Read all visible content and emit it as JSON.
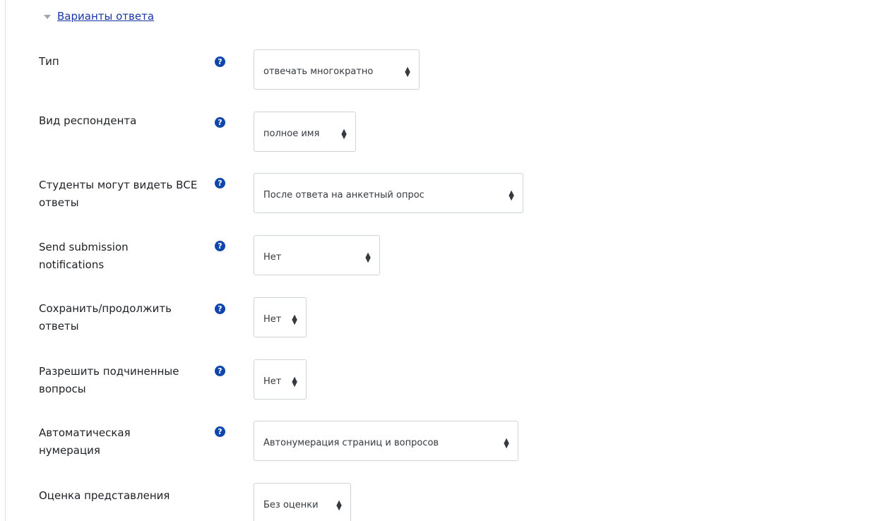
{
  "section": {
    "title": "Варианты ответа"
  },
  "fields": [
    {
      "label": "Тип",
      "value": "отвечать многократно"
    },
    {
      "label": "Вид респондента",
      "value": "полное имя"
    },
    {
      "label": "Студенты могут видеть ВСЕ ответы",
      "value": "После ответа на анкетный опрос"
    },
    {
      "label": "Send submission notifications",
      "value": "Нет"
    },
    {
      "label": "Сохранить/продолжить ответы",
      "value": "Нет"
    },
    {
      "label": "Разрешить подчиненные вопросы",
      "value": "Нет"
    },
    {
      "label": "Автоматическая нумерация",
      "value": "Автонумерация страниц и вопросов"
    },
    {
      "label": "Оценка представления",
      "value": "Без оценки"
    }
  ],
  "icons": {
    "help": "question-circle-icon",
    "select_arrow": "sort-arrows-icon",
    "section_toggle": "caret-down-icon"
  },
  "colors": {
    "link": "#1a35a8",
    "help_icon": "#0f47ad",
    "border": "#ced4da"
  }
}
